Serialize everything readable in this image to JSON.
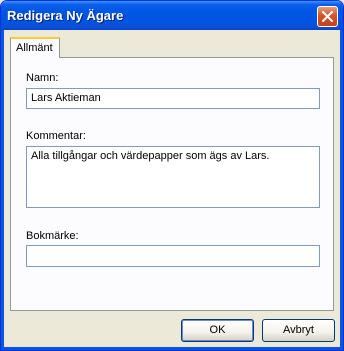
{
  "window": {
    "title": "Redigera Ny Ägare",
    "close_icon": "close-icon"
  },
  "tabs": [
    {
      "label": "Allmänt",
      "active": true
    }
  ],
  "form": {
    "name_label": "Namn:",
    "name_value": "Lars Aktieman",
    "comment_label": "Kommentar:",
    "comment_value": "Alla tillgångar och värdepapper som ägs av Lars.",
    "bookmark_label": "Bokmärke:",
    "bookmark_value": ""
  },
  "buttons": {
    "ok": "OK",
    "cancel": "Avbryt"
  },
  "colors": {
    "titlebar": "#0054e3",
    "frame": "#0a55e0",
    "dialog_bg": "#ece9d8",
    "tab_accent": "#ffc83c",
    "close_button": "#d2532c"
  }
}
